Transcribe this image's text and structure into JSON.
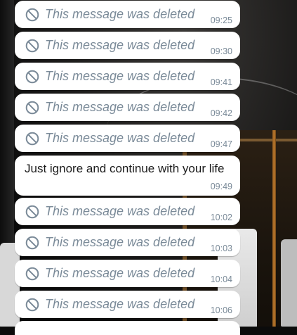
{
  "chat": {
    "messages": [
      {
        "type": "deleted",
        "text": "This message was deleted",
        "time": "09:25",
        "icon": "ban-icon"
      },
      {
        "type": "deleted",
        "text": "This message was deleted",
        "time": "09:30",
        "icon": "ban-icon"
      },
      {
        "type": "deleted",
        "text": "This message was deleted",
        "time": "09:41",
        "icon": "ban-icon"
      },
      {
        "type": "deleted",
        "text": "This message was deleted",
        "time": "09:42",
        "icon": "ban-icon"
      },
      {
        "type": "deleted",
        "text": "This message was deleted",
        "time": "09:47",
        "icon": "ban-icon"
      },
      {
        "type": "text",
        "text": "Just ignore and continue with your life",
        "time": "09:49"
      },
      {
        "type": "deleted",
        "text": "This message was deleted",
        "time": "10:02",
        "icon": "ban-icon"
      },
      {
        "type": "deleted",
        "text": "This message was deleted",
        "time": "10:03",
        "icon": "ban-icon"
      },
      {
        "type": "deleted",
        "text": "This message was deleted",
        "time": "10:04",
        "icon": "ban-icon"
      },
      {
        "type": "deleted",
        "text": "This message was deleted",
        "time": "10:06",
        "icon": "ban-icon"
      }
    ]
  },
  "colors": {
    "bubble": "#ffffff",
    "deleted_text": "#7a8a98",
    "message_text": "#1b1b1b",
    "wood_accent": "#c07a2c"
  }
}
